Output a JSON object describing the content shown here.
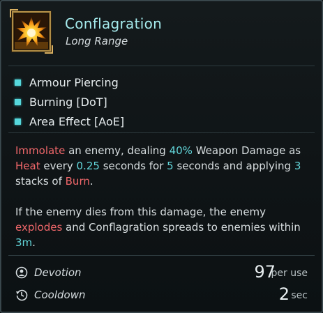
{
  "skill": {
    "name": "Conflagration",
    "range": "Long Range",
    "icon": "explosion-icon"
  },
  "traits": [
    "Armour Piercing",
    "Burning [DoT]",
    "Area Effect [AoE]"
  ],
  "description": {
    "p1": {
      "s1": "Immolate",
      "s2": " an enemy, dealing ",
      "s3": "40%",
      "s4": " Weapon Damage as ",
      "s5": "Heat",
      "s6": " every ",
      "s7": "0.25",
      "s8": " seconds for ",
      "s9": "5",
      "s10": " seconds and applying ",
      "s11": "3",
      "s12": " stacks of ",
      "s13": "Burn",
      "s14": "."
    },
    "p2": {
      "s1": "If the enemy dies from this damage, the enemy ",
      "s2": "explodes",
      "s3": " and Conflagration spreads to enemies within ",
      "s4": "3m",
      "s5": "."
    }
  },
  "stats": {
    "devotion": {
      "label": "Devotion",
      "value": "97",
      "unit": "per use",
      "icon": "devotion-icon"
    },
    "cooldown": {
      "label": "Cooldown",
      "value": "2",
      "unit": "sec",
      "icon": "cooldown-icon"
    }
  },
  "colors": {
    "title": "#a6ecee",
    "accent_cyan": "#62d5d9",
    "accent_red": "#f0676a",
    "icon_frame": "#b08d46"
  }
}
